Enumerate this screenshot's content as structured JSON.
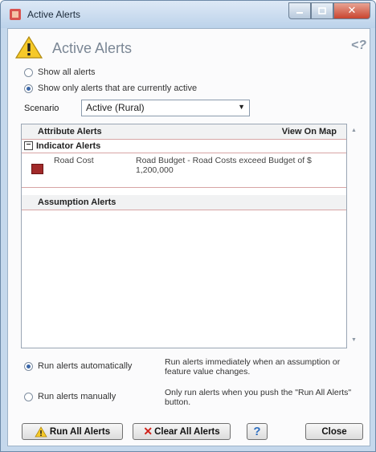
{
  "window": {
    "title": "Active Alerts"
  },
  "header": {
    "title": "Active Alerts"
  },
  "filter": {
    "show_all": "Show all alerts",
    "show_active": "Show only alerts that are currently active"
  },
  "scenario": {
    "label": "Scenario",
    "value": "Active (Rural)"
  },
  "alerts": {
    "attribute_header": "Attribute Alerts",
    "view_on_map": "View On Map",
    "indicator_header": "Indicator Alerts",
    "indicator_items": [
      {
        "name": "Road Cost",
        "description": "Road Budget - Road Costs exceed Budget of $ 1,200,000",
        "color": "#a12a2a"
      }
    ],
    "assumption_header": "Assumption Alerts"
  },
  "run_options": {
    "auto_label": "Run alerts automatically",
    "auto_desc": "Run alerts immediately when an assumption or feature value changes.",
    "manual_label": "Run alerts manually",
    "manual_desc": "Only run alerts when you push the \"Run All Alerts\" button."
  },
  "buttons": {
    "run_all": "Run All Alerts",
    "clear_all": "Clear All Alerts",
    "help": "?",
    "close": "Close"
  },
  "icons": [
    "app-icon",
    "warning-icon",
    "help-icon",
    "minimize-icon",
    "maximize-icon",
    "close-icon",
    "collapse-icon",
    "clear-x-icon",
    "dropdown-arrow-icon"
  ]
}
